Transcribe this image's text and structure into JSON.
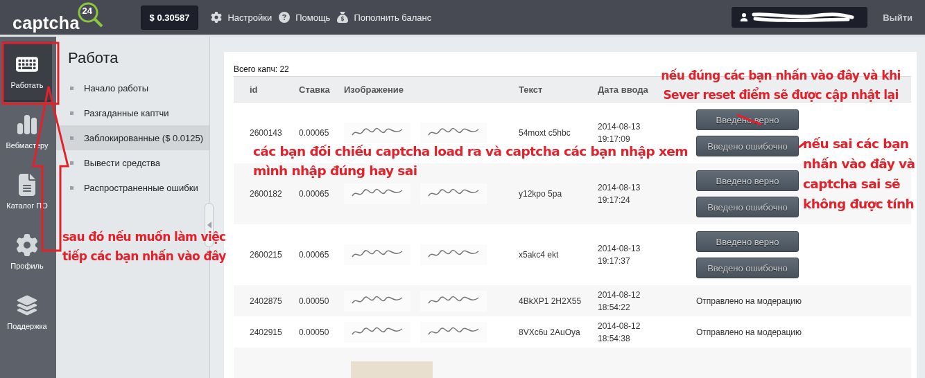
{
  "header": {
    "logo": "captcha",
    "logo_number": "24",
    "balance": "$ 0.30587",
    "menu": [
      {
        "label": "Настройки",
        "kind": "settings"
      },
      {
        "label": "Помощь",
        "kind": "help"
      },
      {
        "label": "Пополнить баланс",
        "kind": "money"
      }
    ],
    "logout": "Выйти"
  },
  "rail": [
    {
      "label": "Работать",
      "kind": "keyboard",
      "selected": true
    },
    {
      "label": "Вебмастеру",
      "kind": "chart",
      "selected": false
    },
    {
      "label": "Каталог ПО",
      "kind": "document",
      "selected": false
    },
    {
      "label": "Профиль",
      "kind": "settings",
      "selected": false
    },
    {
      "label": "Поддержка",
      "kind": "layers",
      "selected": false
    }
  ],
  "section": {
    "title": "Работа",
    "items": [
      {
        "label": "Начало работы",
        "selected": false
      },
      {
        "label": "Разгаданные каптчи",
        "selected": false
      },
      {
        "label": "Заблокированные ($ 0.0125)",
        "selected": true
      },
      {
        "label": "Вывести средства",
        "selected": false
      },
      {
        "label": "Распространенные ошибки",
        "selected": false
      }
    ]
  },
  "table": {
    "total": "Всего капч: 22",
    "columns": [
      "id",
      "Ставка",
      "Изображение",
      "Текст",
      "Дата ввода"
    ],
    "rows": [
      {
        "kind": "pending",
        "id": "2600143",
        "rate": "0.00065",
        "text": "54moxt c5hbc",
        "date": "2014-08-13",
        "time": "19:17:09",
        "actions": [
          "Введено верно",
          "Введено ошибочно"
        ]
      },
      {
        "kind": "pending",
        "id": "2600182",
        "rate": "0.00065",
        "text": "y12kpo 5pa",
        "date": "2014-08-13",
        "time": "19:17:24",
        "actions": [
          "Введено верно",
          "Введено ошибочно"
        ]
      },
      {
        "kind": "pending",
        "id": "2600215",
        "rate": "0.00065",
        "text": "x5akc4 ekt",
        "date": "2014-08-13",
        "time": "19:17:37",
        "actions": [
          "Введено верно",
          "Введено ошибочно"
        ]
      },
      {
        "kind": "status",
        "id": "2402875",
        "rate": "0.00050",
        "text": "4BkXP1 2H2X55",
        "date": "2014-08-12",
        "time": "18:54:22",
        "status": "Отправлено на модерацию"
      },
      {
        "kind": "status",
        "id": "2402915",
        "rate": "0.00050",
        "text": "8VXc6u 2AuOya",
        "date": "2014-08-12",
        "time": "18:54:38",
        "status": "Отправлено на модерацию"
      },
      {
        "kind": "partial"
      }
    ]
  },
  "annotations": [
    {
      "kind": "top",
      "text": "nếu đúng các bạn nhấn vào đây và khi Sever reset điểm sẽ được cập nhật lại"
    },
    {
      "kind": "middle",
      "text": "các bạn đối chiếu captcha load ra và captcha các bạn nhập xem mình nhập đúng hay sai"
    },
    {
      "kind": "right",
      "text": "nếu sai các bạn nhấn vào đây và captcha sai sẽ không được tính"
    },
    {
      "kind": "left",
      "text": "sau đó nếu muốn làm việc tiếp các bạn nhấn vào đây"
    }
  ]
}
